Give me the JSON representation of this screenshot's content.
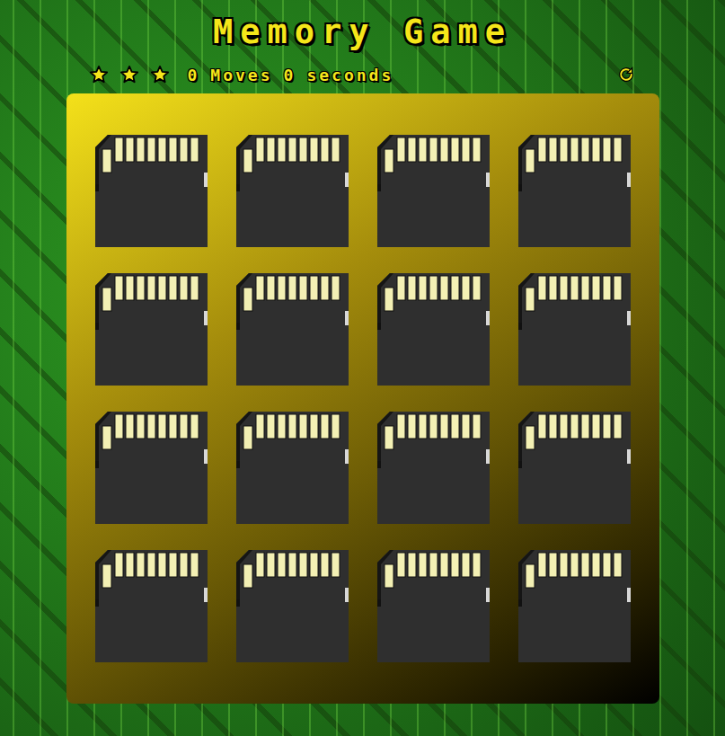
{
  "title": "Memory Game",
  "score_panel": {
    "stars": 3,
    "total_stars": 3,
    "moves": "0",
    "moves_label": "Moves",
    "seconds": "0",
    "seconds_label": "seconds"
  },
  "cards": [
    {
      "open": false
    },
    {
      "open": false
    },
    {
      "open": false
    },
    {
      "open": false
    },
    {
      "open": false
    },
    {
      "open": false
    },
    {
      "open": false
    },
    {
      "open": false
    },
    {
      "open": false
    },
    {
      "open": false
    },
    {
      "open": false
    },
    {
      "open": false
    },
    {
      "open": false
    },
    {
      "open": false
    },
    {
      "open": false
    },
    {
      "open": false
    }
  ]
}
